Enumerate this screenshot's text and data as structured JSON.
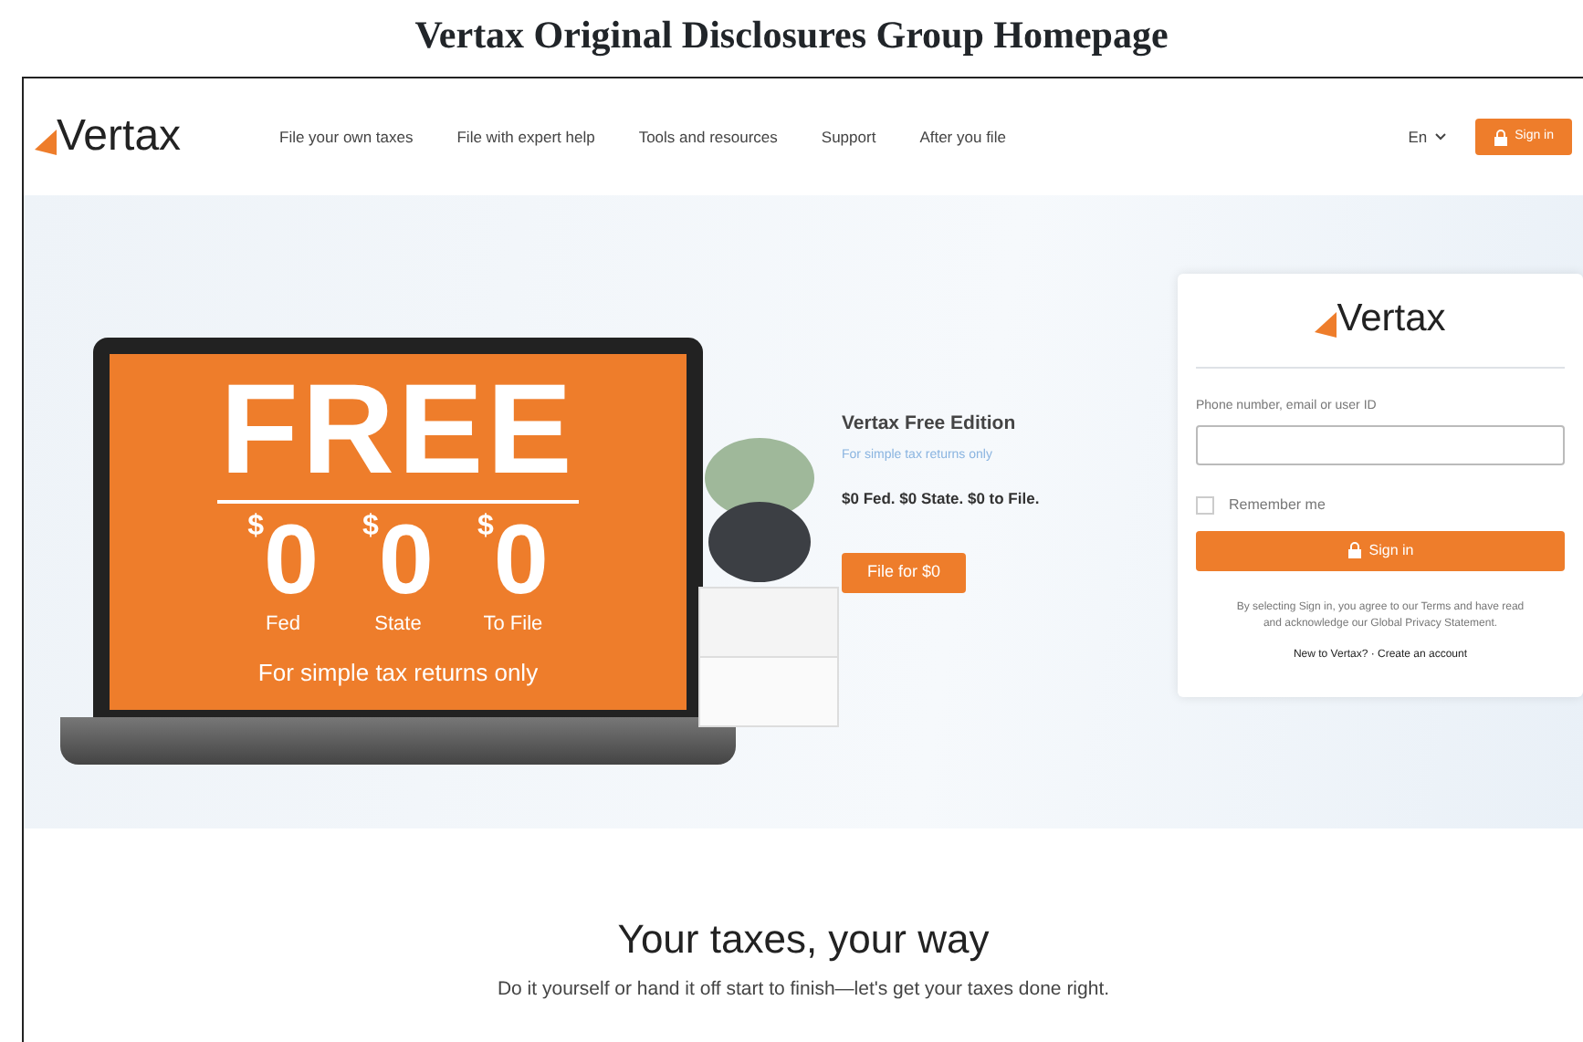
{
  "figure_title": "Vertax Original Disclosures Group Homepage",
  "nav": {
    "logo": "Vertax",
    "links": [
      "File your own taxes",
      "File with expert help",
      "Tools and resources",
      "Support",
      "After you file"
    ],
    "language": "En",
    "sign_in": "Sign in"
  },
  "hero": {
    "laptop_screen": {
      "headline": "FREE",
      "amounts": [
        {
          "currency": "$",
          "value": "0",
          "label": "Fed"
        },
        {
          "currency": "$",
          "value": "0",
          "label": "State"
        },
        {
          "currency": "$",
          "value": "0",
          "label": "To File"
        }
      ],
      "note": "For simple tax returns only"
    },
    "offer": {
      "title": "Vertax Free Edition",
      "subtitle": "For simple tax returns only",
      "details": "$0 Fed. $0 State. $0 to File.",
      "button": "File for $0"
    }
  },
  "login_card": {
    "logo": "Vertax",
    "field_label": "Phone number, email or user ID",
    "remember": {
      "label": "Remember me",
      "checked": false
    },
    "button": "Sign in",
    "legal": "By selecting Sign in, you agree to our Terms and have read and acknowledge our Global Privacy Statement.",
    "signup": "New to Vertax? · Create an account"
  },
  "section": {
    "heading": "Your taxes, your way",
    "subheading": "Do it yourself or hand it off start to finish—let's get your taxes done right."
  }
}
